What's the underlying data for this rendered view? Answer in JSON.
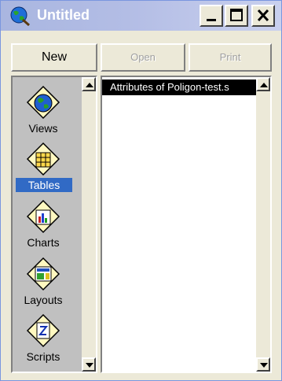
{
  "window": {
    "title": "Untitled"
  },
  "toolbar": {
    "new_label": "New",
    "open_label": "Open",
    "print_label": "Print"
  },
  "doc_types": [
    {
      "label": "Views",
      "icon": "globe-icon",
      "selected": false
    },
    {
      "label": "Tables",
      "icon": "table-icon",
      "selected": true
    },
    {
      "label": "Charts",
      "icon": "chart-icon",
      "selected": false
    },
    {
      "label": "Layouts",
      "icon": "layout-icon",
      "selected": false
    },
    {
      "label": "Scripts",
      "icon": "script-icon",
      "selected": false
    }
  ],
  "documents": [
    {
      "label": "Attributes of Poligon-test.s",
      "selected": true
    }
  ],
  "colors": {
    "titlebar": "#a9b6e0",
    "selection": "#316ac5",
    "face": "#ece9d8"
  }
}
